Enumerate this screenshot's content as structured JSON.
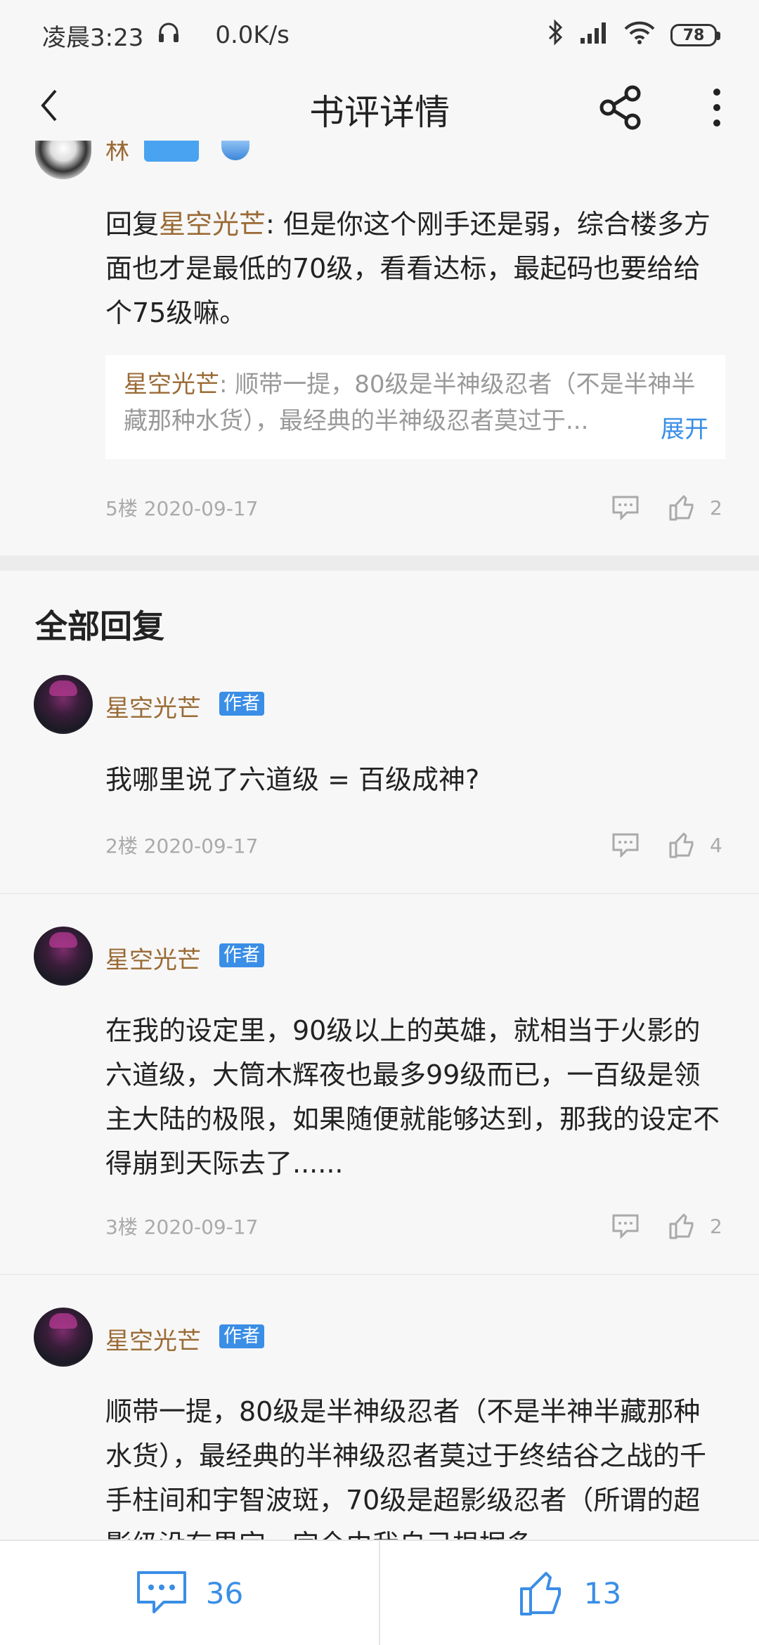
{
  "status": {
    "time": "凌晨3:23",
    "speed": "0.0K/s",
    "battery": "78"
  },
  "nav": {
    "title": "书评详情"
  },
  "top_comment": {
    "partial_name": "林",
    "reply_prefix": "回复",
    "reply_target": "星空光芒",
    "reply_body": ": 但是你这个刚手还是弱，综合楼多方面也才是最低的70级，看看达标，最起码也要给给个75级嘛。",
    "quote_name": "星空光芒",
    "quote_text": ": 顺带一提，80级是半神级忍者（不是半神半藏那种水货），最经典的半神级忍者莫过于...",
    "quote_expand": "展开",
    "meta": "5楼 2020-09-17",
    "likes": "2"
  },
  "section": {
    "title": "全部回复"
  },
  "comments": [
    {
      "name": "星空光芒",
      "badge": "作者",
      "text": "我哪里说了六道级 = 百级成神?",
      "meta": "2楼 2020-09-17",
      "likes": "4"
    },
    {
      "name": "星空光芒",
      "badge": "作者",
      "text": "在我的设定里，90级以上的英雄，就相当于火影的六道级，大筒木辉夜也最多99级而已，一百级是领主大陆的极限，如果随便就能够达到，那我的设定不得崩到天际去了......",
      "meta": "3楼 2020-09-17",
      "likes": "2"
    },
    {
      "name": "星空光芒",
      "badge": "作者",
      "text": "顺带一提，80级是半神级忍者（不是半神半藏那种水货），最经典的半神级忍者莫过于终结谷之战的千手柱间和宇智波斑，70级是超影级忍者（所谓的超影级没有界定，完全由我自己根据多",
      "meta": "",
      "likes": ""
    }
  ],
  "bottom": {
    "comment_count": "36",
    "like_count": "13"
  },
  "colors": {
    "accent": "#3a8ee6",
    "name": "#9a6a34"
  }
}
